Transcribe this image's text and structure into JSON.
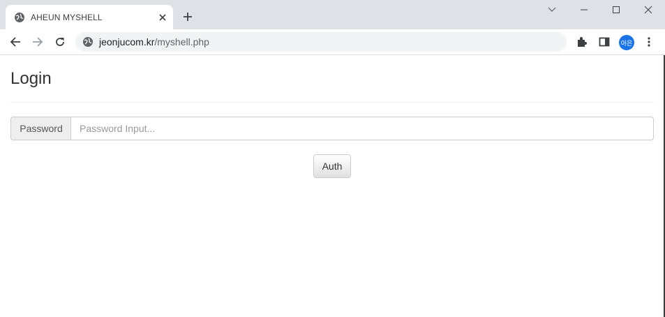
{
  "browser": {
    "tab_title": "AHEUN MYSHELL",
    "url_host": "jeonjucom.kr",
    "url_path": "/myshell.php",
    "profile_avatar": "아은",
    "icons": [
      "globe-icon",
      "close-icon",
      "plus-icon",
      "chevron-down-icon",
      "minimize-icon",
      "maximize-icon",
      "window-close-icon",
      "back-arrow-icon",
      "forward-arrow-icon",
      "reload-icon",
      "site-info-icon",
      "extensions-icon",
      "side-panel-icon",
      "more-vert-icon"
    ]
  },
  "page": {
    "title": "Login",
    "password_label": "Password",
    "password_placeholder": "Password Input...",
    "password_value": "",
    "auth_label": "Auth"
  },
  "colors": {
    "tabstrip": "#dee1e6",
    "omnibox": "#f1f3f4",
    "avatar": "#1a73e8"
  }
}
